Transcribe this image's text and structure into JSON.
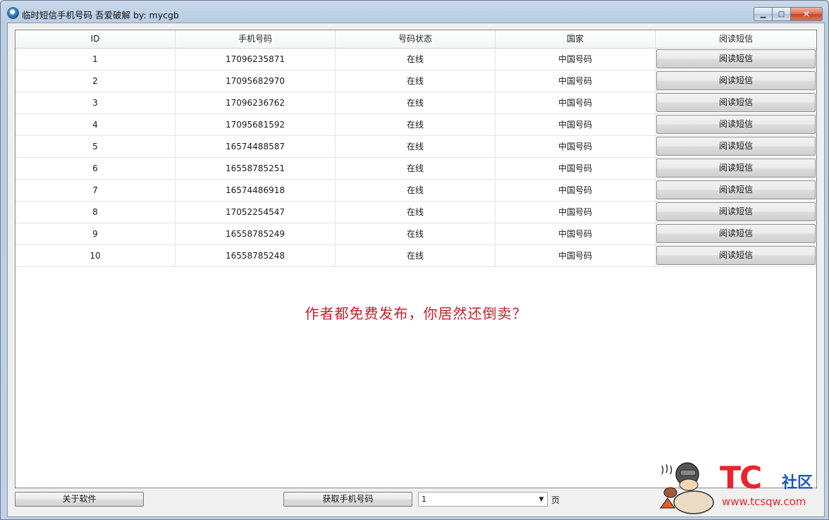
{
  "window": {
    "title": "临时短信手机号码 吾爱破解 by: mycgb",
    "minimize_glyph": "▁",
    "maximize_glyph": "□",
    "close_glyph": "✕"
  },
  "table": {
    "columns": [
      "ID",
      "手机号码",
      "号码状态",
      "国家",
      "阅读短信"
    ],
    "rows": [
      {
        "id": "1",
        "phone": "17096235871",
        "status": "在线",
        "country": "中国号码",
        "action": "阅读短信"
      },
      {
        "id": "2",
        "phone": "17095682970",
        "status": "在线",
        "country": "中国号码",
        "action": "阅读短信"
      },
      {
        "id": "3",
        "phone": "17096236762",
        "status": "在线",
        "country": "中国号码",
        "action": "阅读短信"
      },
      {
        "id": "4",
        "phone": "17095681592",
        "status": "在线",
        "country": "中国号码",
        "action": "阅读短信"
      },
      {
        "id": "5",
        "phone": "16574488587",
        "status": "在线",
        "country": "中国号码",
        "action": "阅读短信"
      },
      {
        "id": "6",
        "phone": "16558785251",
        "status": "在线",
        "country": "中国号码",
        "action": "阅读短信"
      },
      {
        "id": "7",
        "phone": "16574486918",
        "status": "在线",
        "country": "中国号码",
        "action": "阅读短信"
      },
      {
        "id": "8",
        "phone": "17052254547",
        "status": "在线",
        "country": "中国号码",
        "action": "阅读短信"
      },
      {
        "id": "9",
        "phone": "16558785249",
        "status": "在线",
        "country": "中国号码",
        "action": "阅读短信"
      },
      {
        "id": "10",
        "phone": "16558785248",
        "status": "在线",
        "country": "中国号码",
        "action": "阅读短信"
      }
    ]
  },
  "notice": "作者都免费发布，你居然还倒卖？",
  "bottom": {
    "about_label": "关于软件",
    "get_label": "获取手机号码",
    "page_value": "1",
    "page_suffix": "页"
  },
  "watermark": {
    "brand": "TC",
    "sub": "社区",
    "url": "www.tcsqw.com"
  },
  "colors": {
    "notice": "#c0212b",
    "brand_red": "#e8242e",
    "brand_blue": "#1a58b8"
  }
}
